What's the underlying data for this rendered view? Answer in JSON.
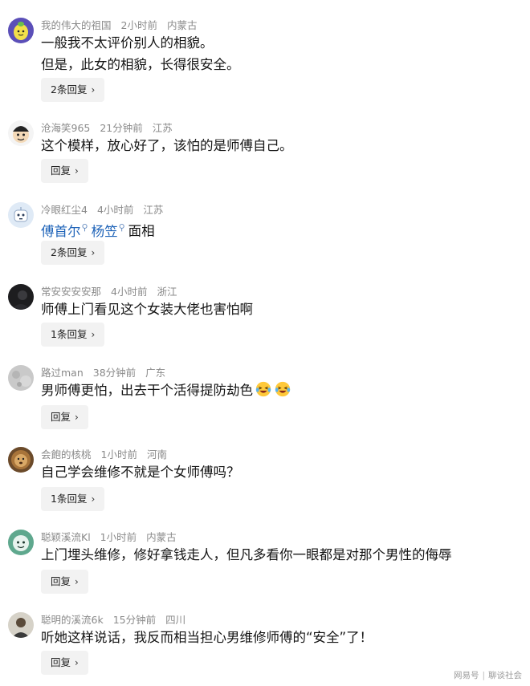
{
  "comments": [
    {
      "username": "我的伟大的祖国",
      "time": "2小时前",
      "location": "内蒙古",
      "lines": [
        "一般我不太评价别人的相貌。",
        "但是，此女的相貌，长得很安全。"
      ],
      "reply_label": "2条回复",
      "avatar_icon": "lemon-avatar-icon"
    },
    {
      "username": "沧海笑965",
      "time": "21分钟前",
      "location": "江苏",
      "lines": [
        "这个模样，放心好了，该怕的是师傅自己。"
      ],
      "reply_label": "回复",
      "avatar_icon": "cartoon-face-avatar-icon"
    },
    {
      "username": "冷眼红尘4",
      "time": "4小时前",
      "location": "江苏",
      "mentions": [
        "傅首尔",
        "杨笠"
      ],
      "text_after": "面相",
      "reply_label": "2条回复",
      "avatar_icon": "robot-avatar-icon"
    },
    {
      "username": "常安安安安那",
      "time": "4小时前",
      "location": "浙江",
      "lines": [
        "师傅上门看见这个女装大佬也害怕啊"
      ],
      "reply_label": "1条回复",
      "avatar_icon": "dark-photo-avatar-icon"
    },
    {
      "username": "路过man",
      "time": "38分钟前",
      "location": "广东",
      "lines": [
        "男师傅更怕，出去干个活得提防劫色"
      ],
      "emojis": [
        "laughing-crying-emoji",
        "laughing-crying-emoji"
      ],
      "reply_label": "回复",
      "avatar_icon": "gray-texture-avatar-icon"
    },
    {
      "username": "会飽的核桃",
      "time": "1小时前",
      "location": "河南",
      "lines": [
        "自己学会维修不就是个女师傅吗？"
      ],
      "reply_label": "1条回复",
      "avatar_icon": "lion-avatar-icon"
    },
    {
      "username": "聪颖溪流Kl",
      "time": "1小时前",
      "location": "内蒙古",
      "lines": [
        "上门埋头维修，修好拿钱走人，但凡多看你一眼都是对那个男性的侮辱"
      ],
      "reply_label": "回复",
      "avatar_icon": "teal-cartoon-avatar-icon"
    },
    {
      "username": "聪明的溪流6k",
      "time": "15分钟前",
      "location": "四川",
      "lines": [
        "听她这样说话，我反而相当担心男维修师傅的“安全”了！"
      ],
      "reply_label": "回复",
      "avatar_icon": "portrait-avatar-icon"
    }
  ],
  "watermark": {
    "left": "网易号",
    "right": "聊谈社会"
  },
  "colors": {
    "meta_text": "#8a8a8a",
    "mention": "#1e63b8",
    "reply_bg": "#f2f2f2"
  }
}
